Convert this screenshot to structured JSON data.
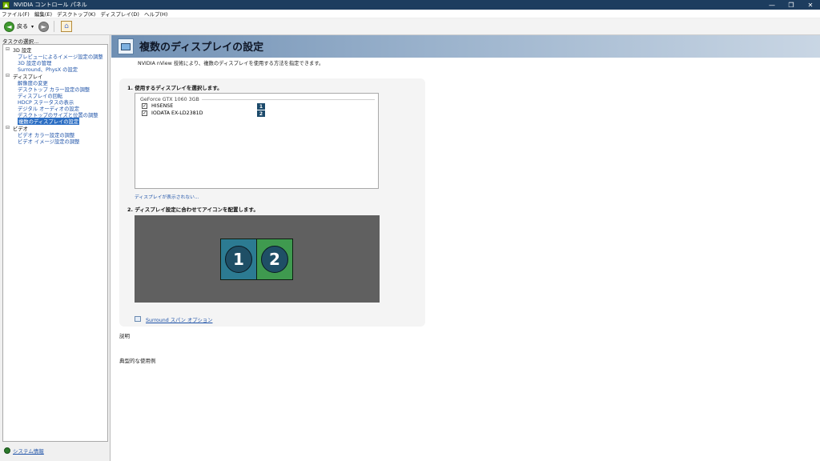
{
  "window": {
    "title": "NVIDIA コントロール パネル",
    "controls": [
      "—",
      "❐",
      "✕"
    ]
  },
  "menu": [
    "ファイル(F)",
    "編集(E)",
    "デスクトップ(K)",
    "ディスプレイ(D)",
    "ヘルプ(H)"
  ],
  "toolbar": {
    "back_label": "戻る",
    "back_dropdown": "▾",
    "forward_icon": "➜"
  },
  "sidebar": {
    "task_label": "タスクの選択...",
    "categories": [
      {
        "label": "3D 設定",
        "items": [
          "プレビューによるイメージ設定の調整",
          "3D 設定の管理",
          "Surround、PhysX の設定"
        ]
      },
      {
        "label": "ディスプレイ",
        "items": [
          "解像度の変更",
          "デスクトップ カラー設定の調整",
          "ディスプレイの回転",
          "HDCP ステータスの表示",
          "デジタル オーディオの設定",
          "デスクトップのサイズと位置の調整",
          "複数のディスプレイの設定"
        ]
      },
      {
        "label": "ビデオ",
        "items": [
          "ビデオ カラー設定の調整",
          "ビデオ イメージ設定の調整"
        ]
      }
    ],
    "selected_item": "複数のディスプレイの設定",
    "sysinfo_label": "システム情報"
  },
  "main": {
    "title": "複数のディスプレイの設定",
    "subtitle": "NVIDIA nView 技術により、複数のディスプレイを使用する方法を指定できます。",
    "step1_label": "1. 使用するディスプレイを選択します。",
    "gpu_name": "GeForce GTX 1060 3GB",
    "displays": [
      {
        "name": "HISENSE",
        "number": "1",
        "checked": true
      },
      {
        "name": "IODATA EX-LD2381D",
        "number": "2",
        "checked": true
      }
    ],
    "hidden_link": "ディスプレイが表示されない...",
    "step2_label": "2. ディスプレイ設定に合わせてアイコンを配置します。",
    "arrangement": [
      {
        "number": "1",
        "color": "#2c7b92"
      },
      {
        "number": "2",
        "color": "#3f9a4f"
      }
    ],
    "surround_link": "Surround スパン オプション",
    "description_label": "説明",
    "usage_label": "典型的な使用例"
  },
  "colors": {
    "title_bar": "#1d3d5f",
    "header_gradient_start": "#6f8fb3",
    "selected_item_bg": "#2d6fc4",
    "link": "#1f53a8",
    "nvidia_green": "#76b900"
  }
}
